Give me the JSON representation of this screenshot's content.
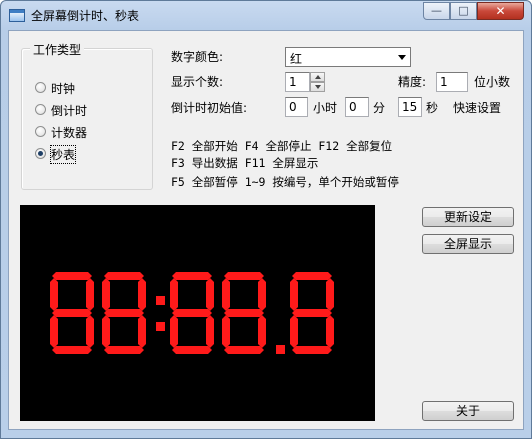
{
  "window": {
    "title": "全屏幕倒计时、秒表",
    "minimize_glyph": "—",
    "maximize_glyph": "□",
    "close_glyph": "✕"
  },
  "mode_group": {
    "label": "工作类型",
    "options": [
      {
        "label": "时钟",
        "selected": false
      },
      {
        "label": "倒计时",
        "selected": false
      },
      {
        "label": "计数器",
        "selected": false
      },
      {
        "label": "秒表",
        "selected": true
      }
    ]
  },
  "settings": {
    "color_label": "数字颜色:",
    "color_value": "红",
    "digit_count_label": "显示个数:",
    "digit_count_value": "1",
    "precision_label": "精度:",
    "precision_value": "1",
    "decimal_label": "位小数",
    "initial_label": "倒计时初始值:",
    "hours_value": "0",
    "hours_unit": "小时",
    "minutes_value": "0",
    "minutes_unit": "分",
    "seconds_value": "15",
    "seconds_unit": "秒",
    "quick_setting": "快速设置"
  },
  "hints": [
    "F2 全部开始 F4 全部停止 F12 全部复位",
    "F3 导出数据 F11 全屏显示",
    "F5 全部暂停 1~9 按编号，单个开始或暂停"
  ],
  "buttons": {
    "update": "更新设定",
    "fullscreen": "全屏显示",
    "about": "关于"
  },
  "display": {
    "text": "88:88.8",
    "segment_color": "#ff1a1a",
    "background": "#000000"
  }
}
